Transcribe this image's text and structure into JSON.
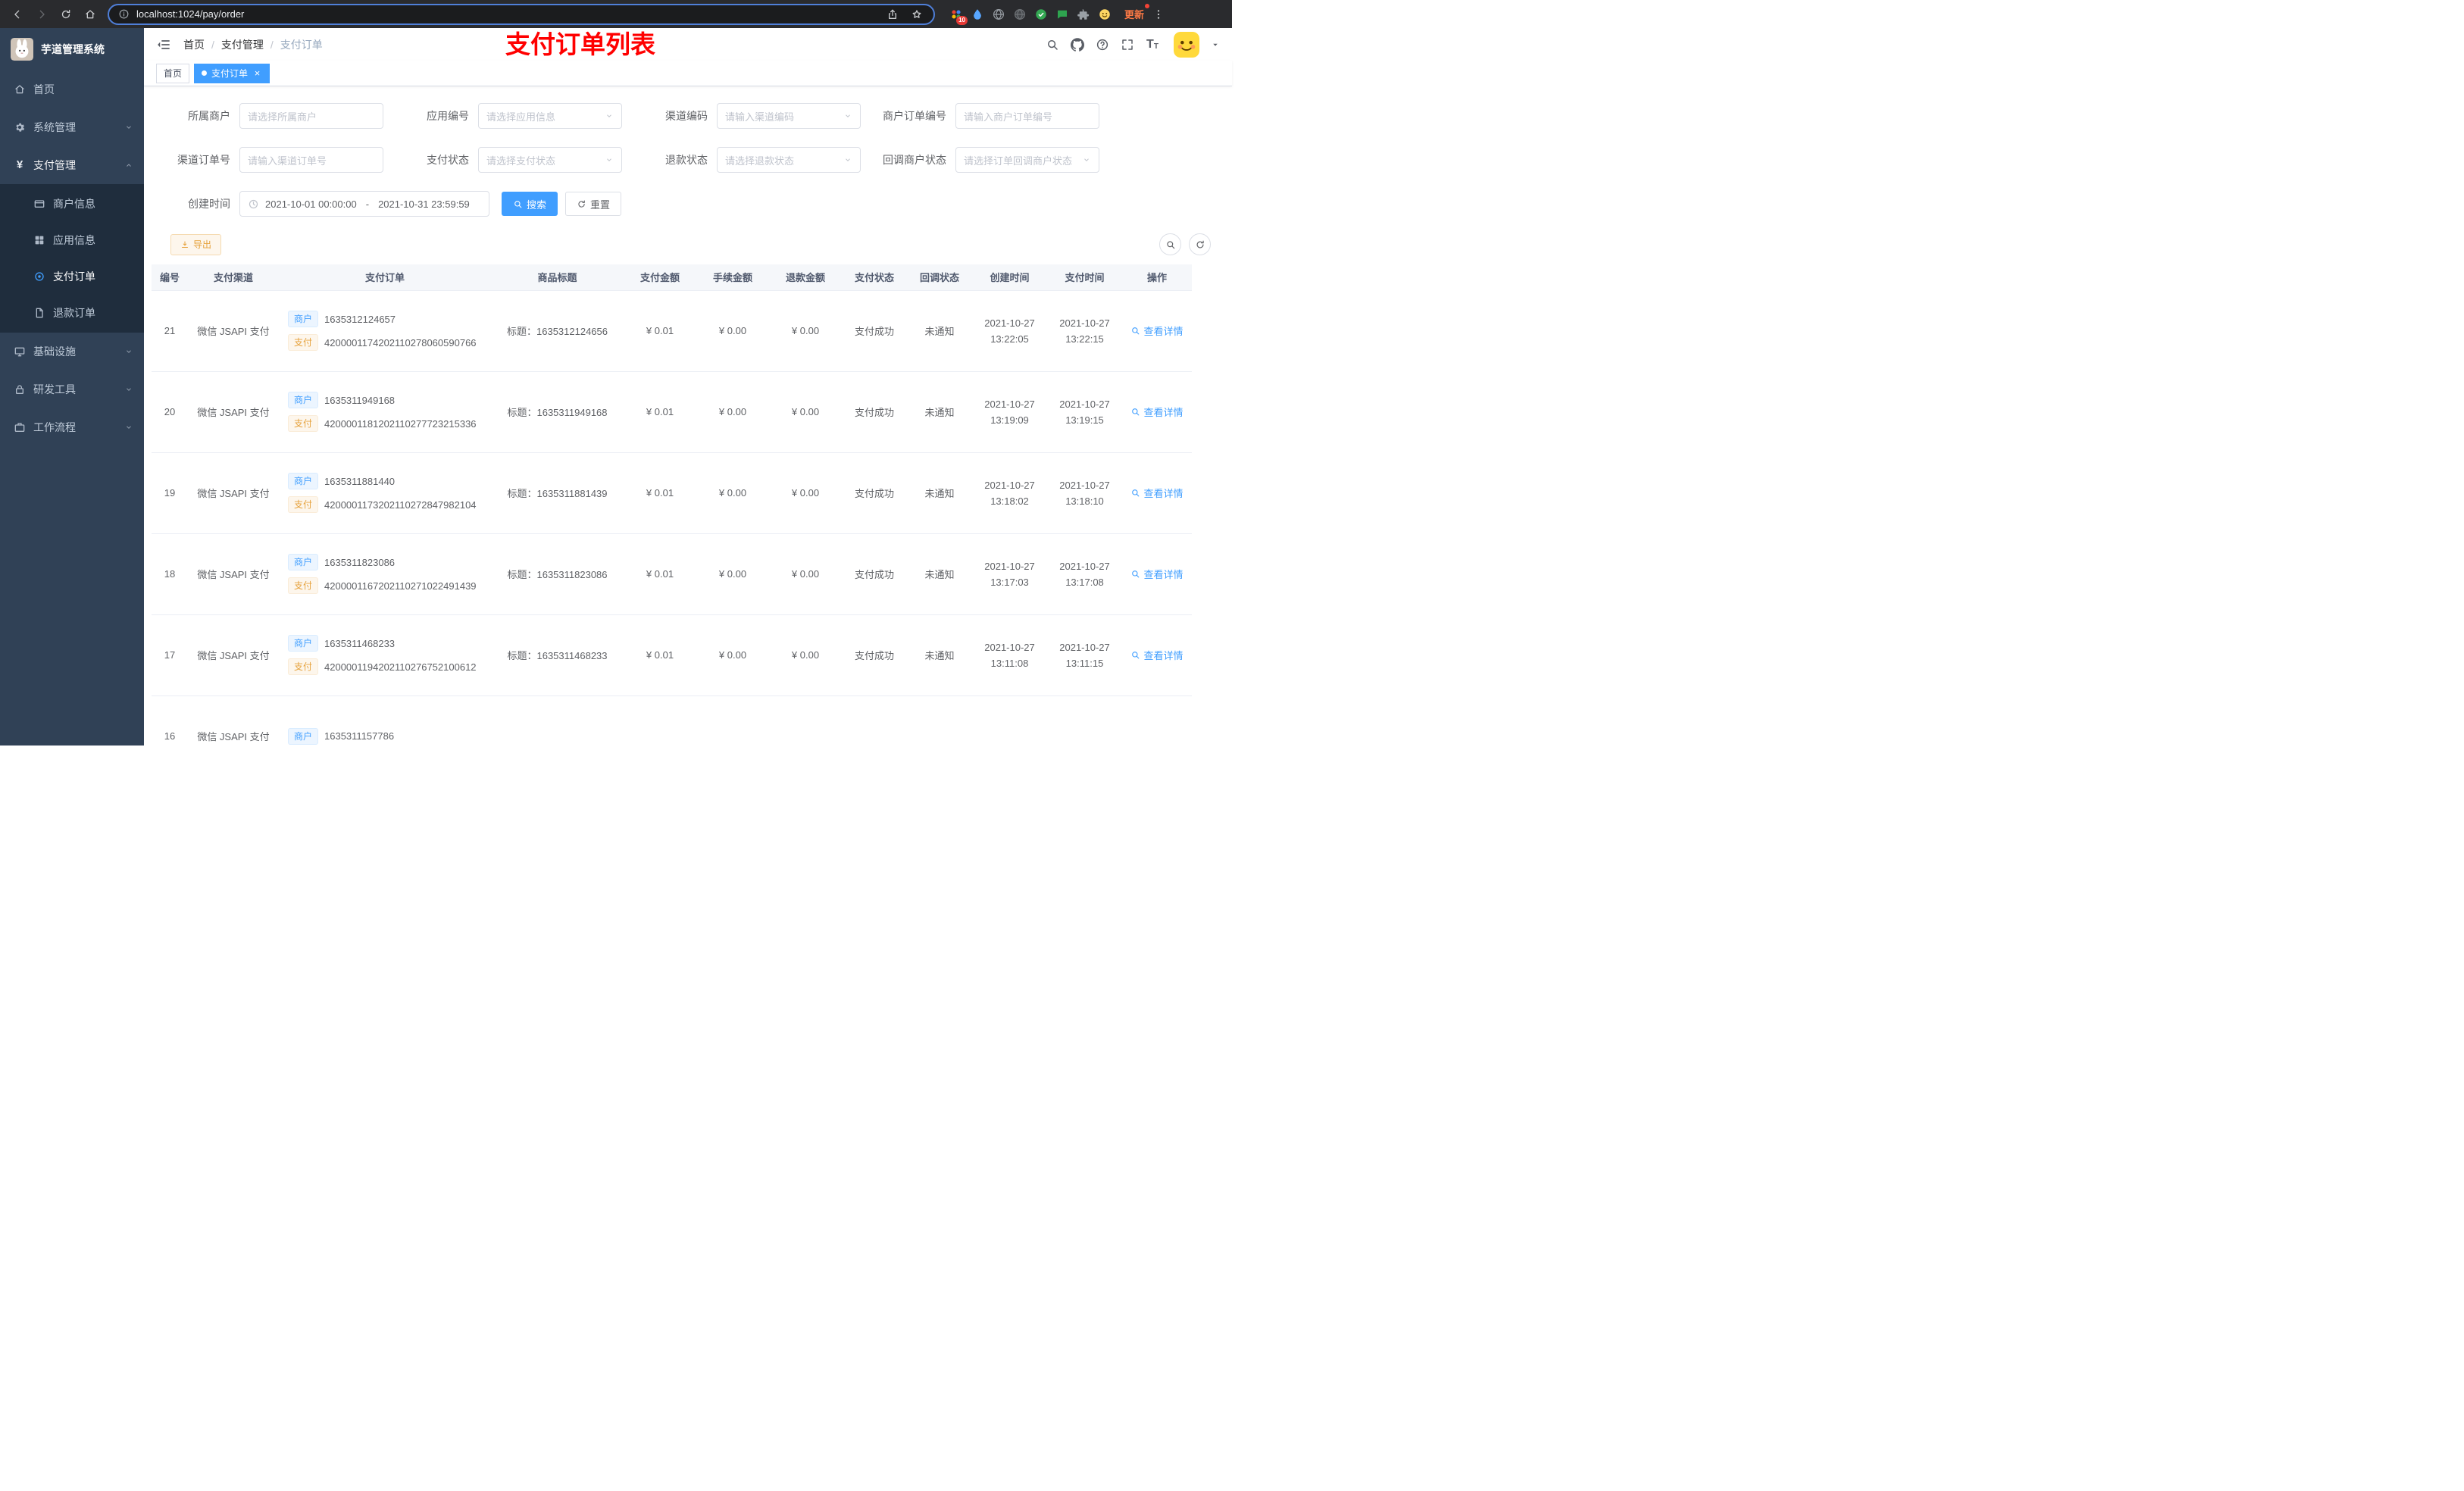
{
  "browser": {
    "url": "localhost:1024/pay/order",
    "nav_icons": [
      "back-icon",
      "forward-icon",
      "refresh-icon",
      "home-icon"
    ],
    "site_icon": "info-icon",
    "pill_icons": [
      "share-icon",
      "star-icon"
    ],
    "ext_icons": [
      "extensions-dots-icon",
      "drop-icon",
      "globe-icon",
      "globe-dark-icon",
      "green-circle-icon",
      "chat-icon",
      "puzzle-icon",
      "emoji-icon"
    ],
    "extension_badge": "10",
    "update_label": "更新",
    "more_icon": "more-vert-icon"
  },
  "sidebar": {
    "logo_icon": "rabbit-logo",
    "logo_title": "芋道管理系统",
    "items": [
      {
        "key": "home",
        "label": "首页",
        "icon": "home-icon",
        "type": "item"
      },
      {
        "key": "system-mgmt",
        "label": "系统管理",
        "icon": "gear-icon",
        "type": "group",
        "expanded": false
      },
      {
        "key": "pay-mgmt",
        "label": "支付管理",
        "icon": "yen-icon",
        "type": "group",
        "expanded": true,
        "children": [
          {
            "key": "merchant-info",
            "label": "商户信息",
            "icon": "card-icon"
          },
          {
            "key": "app-info",
            "label": "应用信息",
            "icon": "grid-icon"
          },
          {
            "key": "pay-order",
            "label": "支付订单",
            "icon": "target-icon",
            "active": true
          },
          {
            "key": "refund-order",
            "label": "退款订单",
            "icon": "doc-icon"
          }
        ]
      },
      {
        "key": "infrastructure",
        "label": "基础设施",
        "icon": "monitor-icon",
        "type": "group",
        "expanded": false
      },
      {
        "key": "dev-tools",
        "label": "研发工具",
        "icon": "lock-icon",
        "type": "group",
        "expanded": false
      },
      {
        "key": "workflow",
        "label": "工作流程",
        "icon": "briefcase-icon",
        "type": "group",
        "expanded": false
      }
    ]
  },
  "header": {
    "fold_icon": "fold-icon",
    "breadcrumb": [
      "首页",
      "支付管理",
      "支付订单"
    ],
    "overlay_title": "支付订单列表",
    "overlay_color": "#ff0000",
    "right_icons": [
      "search-icon",
      "github-icon",
      "question-icon",
      "fullscreen-icon",
      "font-size-icon"
    ],
    "avatar_icon": "avatar-emoji",
    "caret_icon": "caret-down-icon"
  },
  "tabs": [
    {
      "key": "home",
      "label": "首页",
      "active": false,
      "closable": false
    },
    {
      "key": "pay-order",
      "label": "支付订单",
      "active": true,
      "closable": true
    }
  ],
  "filters": {
    "rows": [
      [
        {
          "key": "merchant",
          "label": "所属商户",
          "placeholder": "请选择所属商户",
          "type": "input"
        },
        {
          "key": "app-no",
          "label": "应用编号",
          "placeholder": "请选择应用信息",
          "type": "select"
        },
        {
          "key": "channel-code",
          "label": "渠道编码",
          "placeholder": "请输入渠道编码",
          "type": "select"
        },
        {
          "key": "merchant-order-no",
          "label": "商户订单编号",
          "placeholder": "请输入商户订单编号",
          "type": "input"
        }
      ],
      [
        {
          "key": "channel-order-no",
          "label": "渠道订单号",
          "placeholder": "请输入渠道订单号",
          "type": "input"
        },
        {
          "key": "pay-status",
          "label": "支付状态",
          "placeholder": "请选择支付状态",
          "type": "select"
        },
        {
          "key": "refund-status",
          "label": "退款状态",
          "placeholder": "请选择退款状态",
          "type": "select"
        },
        {
          "key": "callback-status",
          "label": "回调商户状态",
          "placeholder": "请选择订单回调商户状态",
          "type": "select"
        }
      ]
    ],
    "date": {
      "label": "创建时间",
      "icon": "clock-icon",
      "start": "2021-10-01 00:00:00",
      "separator": "-",
      "end": "2021-10-31 23:59:59"
    },
    "search_label": "搜索",
    "search_icon": "search-icon",
    "reset_label": "重置",
    "reset_icon": "refresh-icon"
  },
  "toolbar": {
    "export_label": "导出",
    "export_icon": "download-icon",
    "mini_icons": [
      "search-icon",
      "refresh-icon"
    ]
  },
  "table": {
    "columns": [
      "编号",
      "支付渠道",
      "支付订单",
      "商品标题",
      "支付金额",
      "手续金额",
      "退款金额",
      "支付状态",
      "回调状态",
      "创建时间",
      "支付时间",
      "操作"
    ],
    "merchant_tag": "商户",
    "pay_tag": "支付",
    "title_prefix": "标题：",
    "action_label": "查看详情",
    "action_icon": "search-icon",
    "rows": [
      {
        "id": "21",
        "channel": "微信 JSAPI 支付",
        "merchant_no": "1635312124657",
        "pay_no": "4200001174202110278060590766",
        "title": "1635312124656",
        "pay_amount": "¥ 0.01",
        "fee_amount": "¥ 0.00",
        "refund_amount": "¥ 0.00",
        "pay_status": "支付成功",
        "notify_status": "未通知",
        "create_date": "2021-10-27",
        "create_time": "13:22:05",
        "pay_date": "2021-10-27",
        "pay_time": "13:22:15",
        "partial": false
      },
      {
        "id": "20",
        "channel": "微信 JSAPI 支付",
        "merchant_no": "1635311949168",
        "pay_no": "4200001181202110277723215336",
        "title": "1635311949168",
        "pay_amount": "¥ 0.01",
        "fee_amount": "¥ 0.00",
        "refund_amount": "¥ 0.00",
        "pay_status": "支付成功",
        "notify_status": "未通知",
        "create_date": "2021-10-27",
        "create_time": "13:19:09",
        "pay_date": "2021-10-27",
        "pay_time": "13:19:15",
        "partial": false
      },
      {
        "id": "19",
        "channel": "微信 JSAPI 支付",
        "merchant_no": "1635311881440",
        "pay_no": "4200001173202110272847982104",
        "title": "1635311881439",
        "pay_amount": "¥ 0.01",
        "fee_amount": "¥ 0.00",
        "refund_amount": "¥ 0.00",
        "pay_status": "支付成功",
        "notify_status": "未通知",
        "create_date": "2021-10-27",
        "create_time": "13:18:02",
        "pay_date": "2021-10-27",
        "pay_time": "13:18:10",
        "partial": false
      },
      {
        "id": "18",
        "channel": "微信 JSAPI 支付",
        "merchant_no": "1635311823086",
        "pay_no": "4200001167202110271022491439",
        "title": "1635311823086",
        "pay_amount": "¥ 0.01",
        "fee_amount": "¥ 0.00",
        "refund_amount": "¥ 0.00",
        "pay_status": "支付成功",
        "notify_status": "未通知",
        "create_date": "2021-10-27",
        "create_time": "13:17:03",
        "pay_date": "2021-10-27",
        "pay_time": "13:17:08",
        "partial": false
      },
      {
        "id": "17",
        "channel": "微信 JSAPI 支付",
        "merchant_no": "1635311468233",
        "pay_no": "4200001194202110276752100612",
        "title": "1635311468233",
        "pay_amount": "¥ 0.01",
        "fee_amount": "¥ 0.00",
        "refund_amount": "¥ 0.00",
        "pay_status": "支付成功",
        "notify_status": "未通知",
        "create_date": "2021-10-27",
        "create_time": "13:11:08",
        "pay_date": "2021-10-27",
        "pay_time": "13:11:15",
        "partial": false
      },
      {
        "id": "16",
        "channel": "微信 JSAPI 支付",
        "merchant_no": "1635311157786",
        "pay_no": "",
        "title": "",
        "pay_amount": "",
        "fee_amount": "",
        "refund_amount": "",
        "pay_status": "",
        "notify_status": "",
        "create_date": "",
        "create_time": "",
        "pay_date": "",
        "pay_time": "",
        "partial": true
      }
    ]
  },
  "colors": {
    "primary": "#409eff",
    "warning": "#e6a23c",
    "annotation": "#ff0000",
    "sidebar_bg": "#304156",
    "submenu_bg": "#1f2d3d"
  }
}
